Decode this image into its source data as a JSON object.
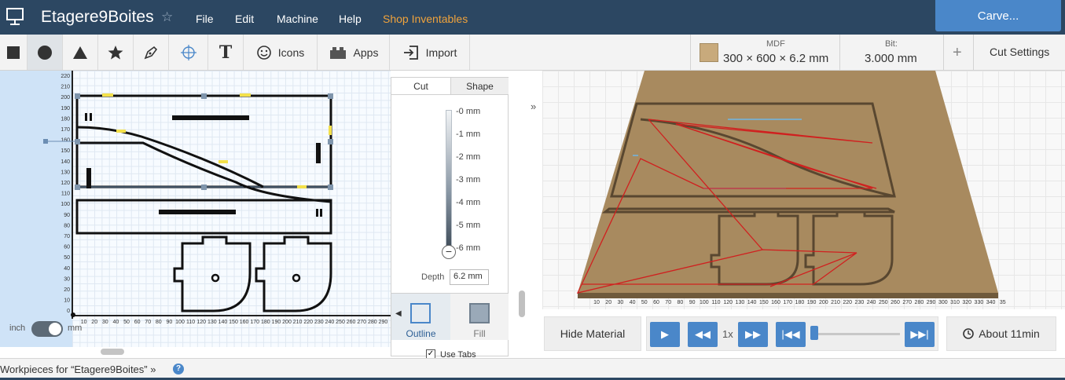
{
  "header": {
    "title": "Etagere9Boites",
    "star": "☆",
    "menu": [
      "File",
      "Edit",
      "Machine",
      "Help",
      "Shop Inventables"
    ],
    "carve_label": "Carve..."
  },
  "toolbar": {
    "icons_label": "Icons",
    "apps_label": "Apps",
    "import_label": "Import",
    "text_tool_glyph": "T"
  },
  "material": {
    "label": "MDF",
    "dimensions": "300 × 600 × 6.2 mm",
    "color": "#c8aa7c"
  },
  "bit": {
    "label": "Bit:",
    "value": "3.000 mm"
  },
  "cut_settings": {
    "add": "+",
    "label": "Cut Settings"
  },
  "canvas2d": {
    "y_ticks": [
      "220",
      "210",
      "200",
      "190",
      "180",
      "170",
      "160",
      "150",
      "140",
      "130",
      "120",
      "110",
      "100",
      "90",
      "80",
      "70",
      "60",
      "50",
      "40",
      "30",
      "20",
      "10",
      "0"
    ],
    "x_ticks": [
      "0",
      "10",
      "20",
      "30",
      "40",
      "50",
      "60",
      "70",
      "80",
      "90",
      "100",
      "110",
      "120",
      "130",
      "140",
      "150",
      "160",
      "170",
      "180",
      "190",
      "200",
      "210",
      "220",
      "230",
      "240",
      "250",
      "260",
      "270",
      "280",
      "290"
    ],
    "units": {
      "left": "inch",
      "right": "mm"
    }
  },
  "cut_panel": {
    "tabs": [
      "Cut",
      "Shape"
    ],
    "depth_ticks": [
      "-0 mm",
      "-1 mm",
      "-2 mm",
      "-3 mm",
      "-4 mm",
      "-5 mm",
      "-6 mm"
    ],
    "depth_knob": "−",
    "depth_label": "Depth",
    "depth_value": "6.2 mm",
    "styles": [
      "Outline",
      "Fill"
    ],
    "use_tabs": "Use Tabs",
    "use_tabs_check": "✓"
  },
  "view3d": {
    "x_ticks": [
      "10",
      "20",
      "30",
      "40",
      "50",
      "60",
      "70",
      "80",
      "90",
      "100",
      "110",
      "120",
      "130",
      "140",
      "150",
      "160",
      "170",
      "180",
      "190",
      "200",
      "210",
      "220",
      "230",
      "240",
      "250",
      "260",
      "270",
      "280",
      "290",
      "300",
      "310",
      "320",
      "330",
      "340",
      "35"
    ]
  },
  "playback": {
    "hide_material": "Hide Material",
    "speed": "1x",
    "about": "About 11min"
  },
  "footer": {
    "workpieces": "Workpieces for “Etagere9Boites” »",
    "help": "?"
  }
}
